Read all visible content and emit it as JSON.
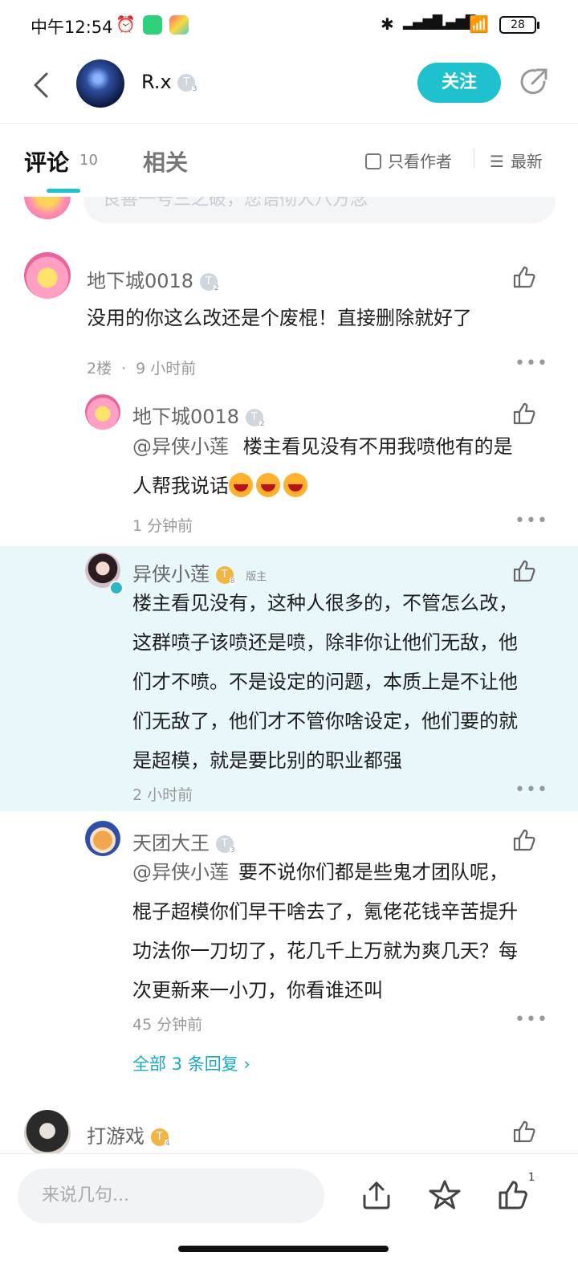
{
  "status_bar": {
    "time": "中午12:54",
    "battery": "28"
  },
  "header": {
    "username": "R.x",
    "level": "T",
    "follow_label": "关注"
  },
  "tabs": {
    "comment_label": "评论",
    "comment_count": "10",
    "related_label": "相关",
    "only_author_label": "只看作者",
    "sort_label": "最新"
  },
  "faded_item": {
    "text": "良善一号三之破，您语彻人八方念"
  },
  "comments": [
    {
      "user": "地下城0018",
      "level": "T",
      "text": "没用的你这么改还是个废棍！直接删除就好了",
      "floor": "2楼",
      "time": "9 小时前"
    }
  ],
  "replies": [
    {
      "user": "地下城0018",
      "level": "T",
      "mention": "@异侠小莲",
      "text_line1": "楼主看见没有不用我喷他有的是",
      "text_line2": "人帮我说话",
      "time": "1 分钟前"
    },
    {
      "user": "异侠小莲",
      "level": "T",
      "tag": "版主",
      "lines": [
        "楼主看见没有，这种人很多的，不管怎么改，",
        "这群喷子该喷还是喷，除非你让他们无敌，他",
        "们才不喷。不是设定的问题，本质上是不让他",
        "们无敌了，他们才不管你啥设定，他们要的就",
        "是超模，就是要比别的职业都强"
      ],
      "time": "2 小时前"
    },
    {
      "user": "天团大王",
      "level": "T",
      "mention": "@异侠小莲",
      "lines": [
        "要不说你们都是些鬼才团队呢，",
        "棍子超模你们早干啥去了，氪佬花钱辛苦提升",
        "功法你一刀切了，花几千上万就为爽几天？每",
        "次更新来一小刀，你看谁还叫"
      ],
      "time": "45 分钟前"
    }
  ],
  "view_all": "全部 3 条回复 ›",
  "next_comment": {
    "user": "打游戏",
    "level": "T"
  },
  "bottom_bar": {
    "placeholder": "来说几句...",
    "like_count": "1"
  },
  "colors": {
    "accent": "#1fc1cf",
    "highlight": "#e8f7fa",
    "link": "#1aa8c7"
  }
}
